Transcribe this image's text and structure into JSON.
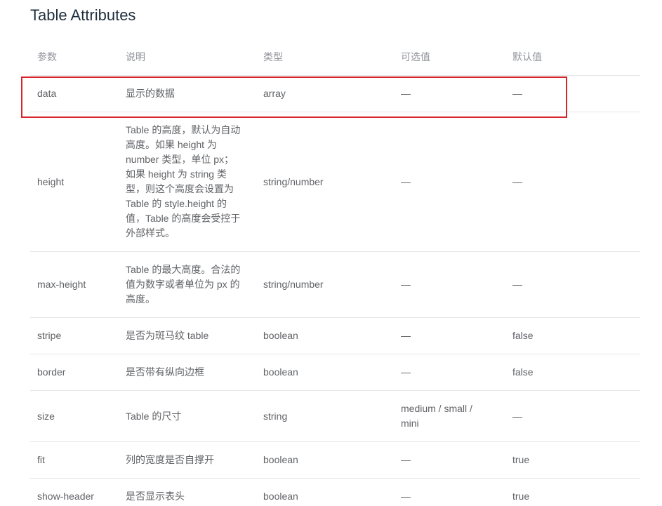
{
  "page": {
    "title": "Table Attributes"
  },
  "table": {
    "headers": [
      "参数",
      "说明",
      "类型",
      "可选值",
      "默认值"
    ],
    "rows": [
      {
        "param": "data",
        "description": "显示的数据",
        "type": "array",
        "options": "—",
        "default": "—"
      },
      {
        "param": "height",
        "description": [
          "Table 的高度，默认为自动",
          "高度。如果 height 为",
          "number 类型，单位 px；",
          "如果 height 为 string 类",
          "型，则这个高度会设置为",
          "Table 的 style.height 的",
          "值，Table 的高度会受控于",
          "外部样式。"
        ],
        "type": "string/number",
        "options": "—",
        "default": "—"
      },
      {
        "param": "max-height",
        "description": [
          "Table 的最大高度。合法的",
          "值为数字或者单位为 px 的",
          "高度。"
        ],
        "type": "string/number",
        "options": "—",
        "default": "—"
      },
      {
        "param": "stripe",
        "description": "是否为斑马纹 table",
        "type": "boolean",
        "options": "—",
        "default": "false"
      },
      {
        "param": "border",
        "description": "是否带有纵向边框",
        "type": "boolean",
        "options": "—",
        "default": "false"
      },
      {
        "param": "size",
        "description": "Table 的尺寸",
        "type": "string",
        "options": [
          "medium / small /",
          "mini"
        ],
        "default": "—"
      },
      {
        "param": "fit",
        "description": "列的宽度是否自撑开",
        "type": "boolean",
        "options": "—",
        "default": "true"
      },
      {
        "param": "show-header",
        "description": "是否显示表头",
        "type": "boolean",
        "options": "—",
        "default": "true"
      }
    ]
  },
  "colors": {
    "title": "#1f2f3d",
    "header_text": "#909399",
    "cell_text": "#606266",
    "border": "#e4e6ea",
    "highlight": "#d7252b",
    "background": "#ffffff"
  }
}
